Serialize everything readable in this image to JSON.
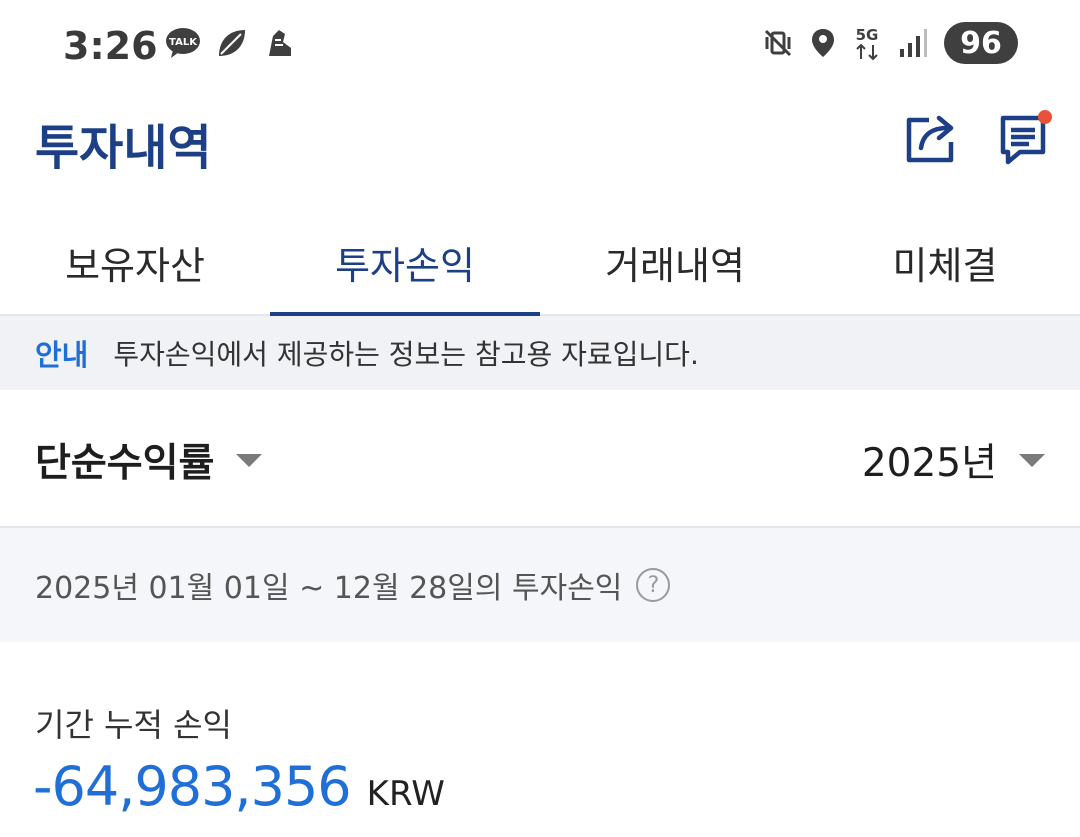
{
  "status_bar": {
    "time": "3:26",
    "left_icons": [
      "talk-icon",
      "leaf-icon",
      "shoe-icon"
    ],
    "right_icons": [
      "vibrate-mute-icon",
      "location-icon",
      "5g-icon",
      "signal-icon"
    ],
    "network_label": "5G",
    "talk_label": "TALK",
    "battery": "96"
  },
  "header": {
    "title": "투자내역",
    "share_icon": "share-icon",
    "chat_icon": "chat-notification-icon",
    "notification_dot_color": "#e8523a"
  },
  "tabs": [
    {
      "label": "보유자산",
      "active": false
    },
    {
      "label": "투자손익",
      "active": true
    },
    {
      "label": "거래내역",
      "active": false
    },
    {
      "label": "미체결",
      "active": false
    }
  ],
  "notice": {
    "label": "안내",
    "text": "투자손익에서 제공하는 정보는 참고용 자료입니다."
  },
  "filters": {
    "return_type": "단순수익률",
    "year": "2025년"
  },
  "period": {
    "text": "2025년 01월 01일 ~ 12월 28일의 투자손익",
    "help_symbol": "?"
  },
  "summary": {
    "label": "기간 누적 손익",
    "amount": "-64,983,356",
    "currency": "KRW"
  },
  "colors": {
    "brand_navy": "#1c3f86",
    "accent_blue": "#1f6fd6"
  }
}
